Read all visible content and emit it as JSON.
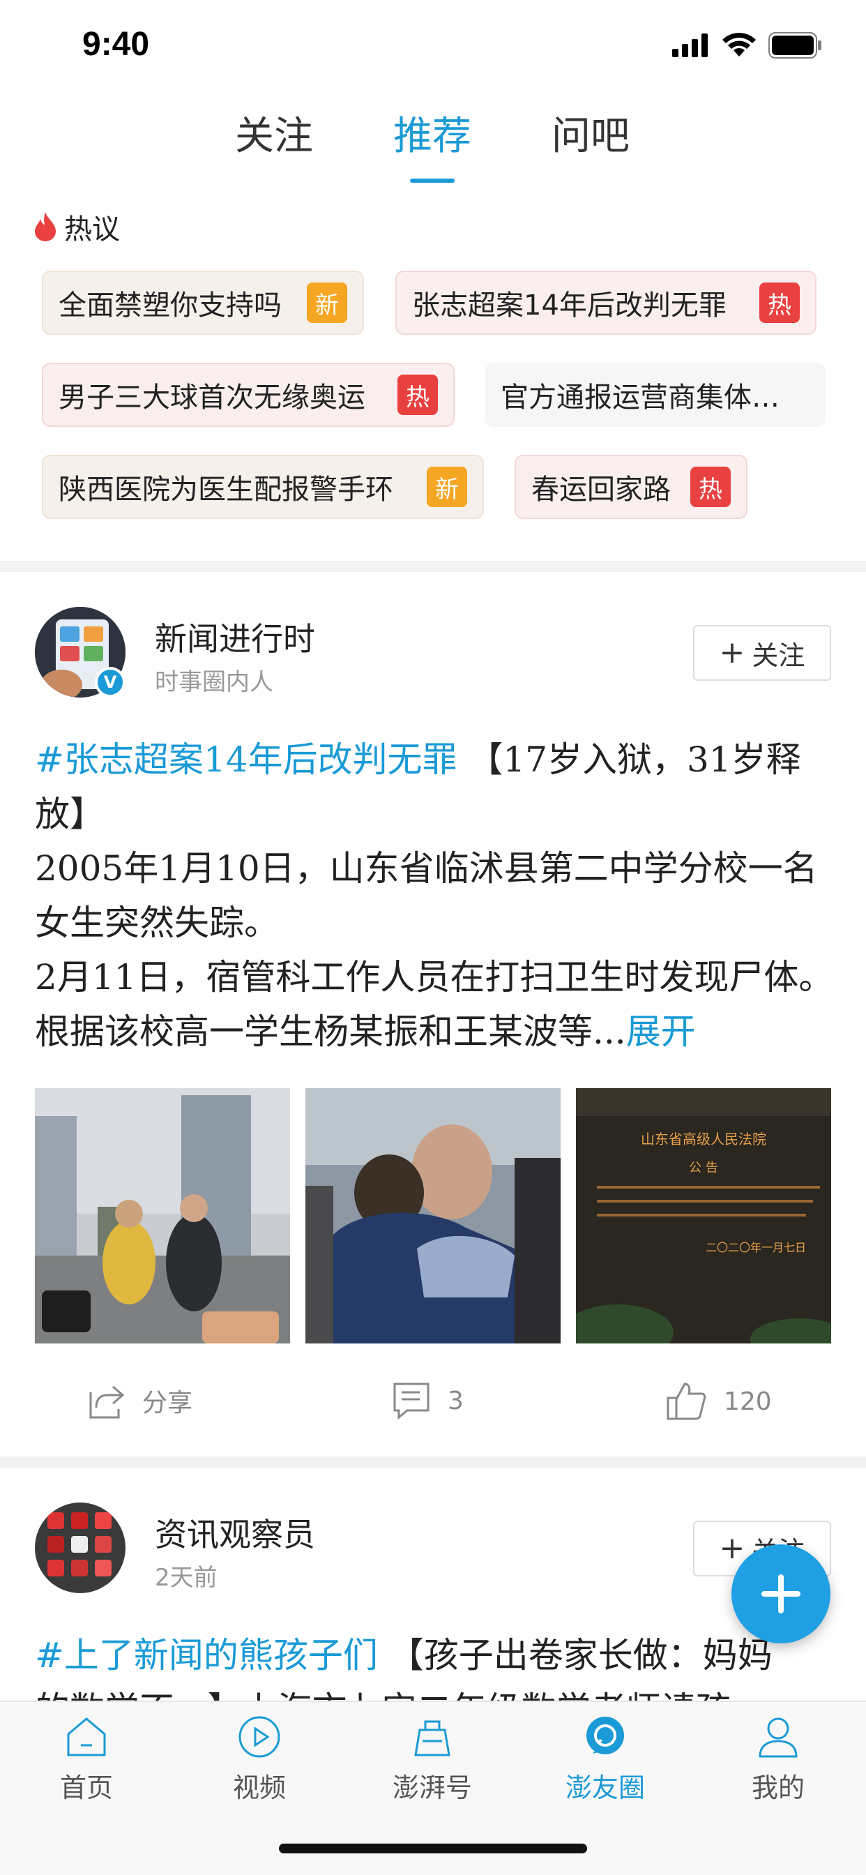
{
  "status_bar": {
    "time": "9:40"
  },
  "top_tabs": [
    {
      "label": "关注"
    },
    {
      "label": "推荐",
      "active": true
    },
    {
      "label": "问吧"
    }
  ],
  "hot": {
    "title": "热议",
    "topics": [
      {
        "text": "全面禁塑你支持吗",
        "badge": "新",
        "type": "new"
      },
      {
        "text": "张志超案14年后改判无罪",
        "badge": "热",
        "type": "hot"
      },
      {
        "text": "男子三大球首次无缘奥运",
        "badge": "热",
        "type": "hot"
      },
      {
        "text": "官方通报运营商集体…",
        "badge": "",
        "type": "plain"
      },
      {
        "text": "陕西医院为医生配报警手环",
        "badge": "新",
        "type": "new"
      },
      {
        "text": "春运回家路",
        "badge": "热",
        "type": "hot"
      }
    ]
  },
  "posts": [
    {
      "author": "新闻进行时",
      "subtitle": "时事圈内人",
      "verified_mark": "V",
      "follow_label": "关注",
      "hashtag": "#张志超案14年后改判无罪",
      "body_1": " 【17岁入狱，31岁释放】",
      "body_2": "2005年1月10日，山东省临沭县第二中学分校一名女生突然失踪。",
      "body_3": "2月11日，宿管科工作人员在打扫卫生时发现尸体。根据该校高一学生杨某振和王某波等...",
      "expand": "展开",
      "photo3_caption": "山东省高级人民法院",
      "photo3_sub": "公 告",
      "photo3_date": "二〇二〇年一月七日",
      "share_label": "分享",
      "comment_count": "3",
      "like_count": "120"
    },
    {
      "author": "资讯观察员",
      "subtitle": "2天前",
      "follow_label": "关注",
      "hashtag": "#上了新闻的熊孩子们",
      "body_1": " 【孩子出卷家长做：妈妈",
      "body_2": "的数学不...】上海市七宝二年级数学老师请孩"
    }
  ],
  "bottom_nav": [
    {
      "label": "首页",
      "icon": "home-icon"
    },
    {
      "label": "视频",
      "icon": "video-play-icon"
    },
    {
      "label": "澎湃号",
      "icon": "account-icon"
    },
    {
      "label": "澎友圈",
      "icon": "chat-bubble-icon",
      "active": true
    },
    {
      "label": "我的",
      "icon": "profile-icon"
    }
  ],
  "colors": {
    "accent": "#1a9ad6",
    "hot": "#e94040",
    "new": "#f5a623"
  }
}
